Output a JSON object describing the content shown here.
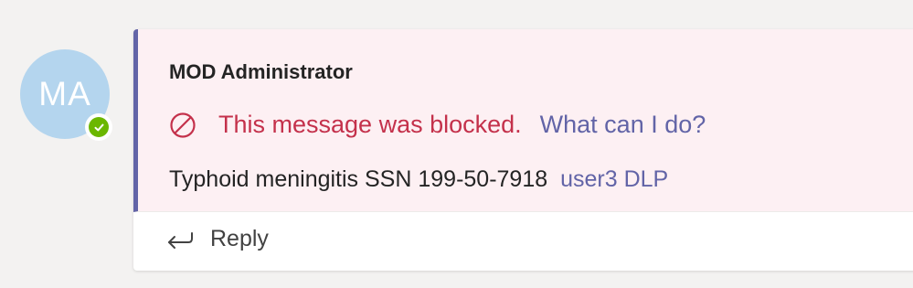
{
  "sender": {
    "initials": "MA",
    "name": "MOD Administrator",
    "presence": "available"
  },
  "message": {
    "blocked_notice": "This message was blocked.",
    "help_link": "What can I do?",
    "body_text": "Typhoid meningitis SSN 199-50-7918",
    "mention": "user3 DLP"
  },
  "actions": {
    "reply_label": "Reply"
  },
  "icons": {
    "blocked": "blocked-icon",
    "presence": "checkmark-icon",
    "reply": "reply-arrow-icon"
  },
  "colors": {
    "accent": "#6264a7",
    "blocked": "#c4314b",
    "message_bg": "#fdf0f3",
    "avatar_bg": "#b4d5ee",
    "presence": "#6bb700"
  }
}
